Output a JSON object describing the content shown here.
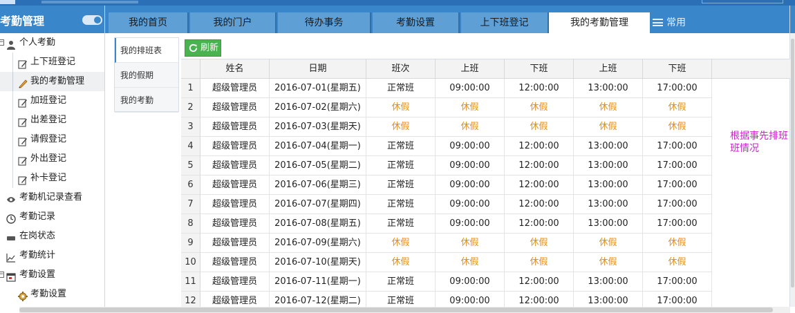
{
  "app": {
    "title": "考勤管理",
    "accent": "#3a86cb"
  },
  "sidebar": {
    "items": [
      {
        "label": "个人考勤",
        "icon": "user-icon",
        "level": 1,
        "expander": "−"
      },
      {
        "label": "上下班登记",
        "icon": "edit-icon",
        "level": 2
      },
      {
        "label": "我的考勤管理",
        "icon": "pencil-icon",
        "level": 2,
        "selected": true
      },
      {
        "label": "加班登记",
        "icon": "edit-icon",
        "level": 2
      },
      {
        "label": "出差登记",
        "icon": "edit-icon",
        "level": 2
      },
      {
        "label": "请假登记",
        "icon": "edit-icon",
        "level": 2
      },
      {
        "label": "外出登记",
        "icon": "edit-icon",
        "level": 2
      },
      {
        "label": "补卡登记",
        "icon": "edit-icon",
        "level": 2
      },
      {
        "label": "考勤机记录查看",
        "icon": "eye-icon",
        "level": 1
      },
      {
        "label": "考勤记录",
        "icon": "clock-icon",
        "level": 1
      },
      {
        "label": "在岗状态",
        "icon": "card-icon",
        "level": 1
      },
      {
        "label": "考勤统计",
        "icon": "chart-line-icon",
        "level": 1
      },
      {
        "label": "考勤设置",
        "icon": "calendar-icon",
        "level": 1,
        "expander": "−"
      },
      {
        "label": "考勤设置",
        "icon": "gear-icon",
        "level": 2
      }
    ]
  },
  "tabs": [
    {
      "label": "我的首页"
    },
    {
      "label": "我的门户"
    },
    {
      "label": "待办事务"
    },
    {
      "label": "考勤设置"
    },
    {
      "label": "上下班登记"
    },
    {
      "label": "我的考勤管理",
      "active": true
    }
  ],
  "tab_more_label": "常用",
  "inner_nav": [
    {
      "label": "我的排班表",
      "active": true
    },
    {
      "label": "我的假期"
    },
    {
      "label": "我的考勤"
    }
  ],
  "toolbar": {
    "refresh_label": "刷新"
  },
  "grid": {
    "columns": [
      "姓名",
      "日期",
      "班次",
      "上班",
      "下班",
      "上班",
      "下班"
    ],
    "rows": [
      {
        "num": "1",
        "name": "超级管理员",
        "date": "2016-07-01(星期五)",
        "shift": "正常班",
        "in1": "09:00:00",
        "out1": "12:00:00",
        "in2": "13:00:00",
        "out2": "17:00:00",
        "holiday": false
      },
      {
        "num": "2",
        "name": "超级管理员",
        "date": "2016-07-02(星期六)",
        "shift": "休假",
        "in1": "休假",
        "out1": "休假",
        "in2": "休假",
        "out2": "休假",
        "holiday": true
      },
      {
        "num": "3",
        "name": "超级管理员",
        "date": "2016-07-03(星期天)",
        "shift": "休假",
        "in1": "休假",
        "out1": "休假",
        "in2": "休假",
        "out2": "休假",
        "holiday": true
      },
      {
        "num": "4",
        "name": "超级管理员",
        "date": "2016-07-04(星期一)",
        "shift": "正常班",
        "in1": "09:00:00",
        "out1": "12:00:00",
        "in2": "13:00:00",
        "out2": "17:00:00",
        "holiday": false
      },
      {
        "num": "5",
        "name": "超级管理员",
        "date": "2016-07-05(星期二)",
        "shift": "正常班",
        "in1": "09:00:00",
        "out1": "12:00:00",
        "in2": "13:00:00",
        "out2": "17:00:00",
        "holiday": false
      },
      {
        "num": "6",
        "name": "超级管理员",
        "date": "2016-07-06(星期三)",
        "shift": "正常班",
        "in1": "09:00:00",
        "out1": "12:00:00",
        "in2": "13:00:00",
        "out2": "17:00:00",
        "holiday": false
      },
      {
        "num": "7",
        "name": "超级管理员",
        "date": "2016-07-07(星期四)",
        "shift": "正常班",
        "in1": "09:00:00",
        "out1": "12:00:00",
        "in2": "13:00:00",
        "out2": "17:00:00",
        "holiday": false
      },
      {
        "num": "8",
        "name": "超级管理员",
        "date": "2016-07-08(星期五)",
        "shift": "正常班",
        "in1": "09:00:00",
        "out1": "12:00:00",
        "in2": "13:00:00",
        "out2": "17:00:00",
        "holiday": false
      },
      {
        "num": "9",
        "name": "超级管理员",
        "date": "2016-07-09(星期六)",
        "shift": "休假",
        "in1": "休假",
        "out1": "休假",
        "in2": "休假",
        "out2": "休假",
        "holiday": true
      },
      {
        "num": "10",
        "name": "超级管理员",
        "date": "2016-07-10(星期天)",
        "shift": "休假",
        "in1": "休假",
        "out1": "休假",
        "in2": "休假",
        "out2": "休假",
        "holiday": true
      },
      {
        "num": "11",
        "name": "超级管理员",
        "date": "2016-07-11(星期一)",
        "shift": "正常班",
        "in1": "09:00:00",
        "out1": "12:00:00",
        "in2": "13:00:00",
        "out2": "17:00:00",
        "holiday": false
      },
      {
        "num": "12",
        "name": "超级管理员",
        "date": "2016-07-12(星期二)",
        "shift": "正常班",
        "in1": "09:00:00",
        "out1": "12:00:00",
        "in2": "13:00:00",
        "out2": "17:00:00",
        "holiday": false
      }
    ]
  },
  "note": {
    "line1": "根据事先排班",
    "line2": "班情况"
  },
  "colors": {
    "holiday_text": "#e0901e",
    "note_text": "#cc22cc",
    "refresh_bg": "#4ab34f"
  }
}
